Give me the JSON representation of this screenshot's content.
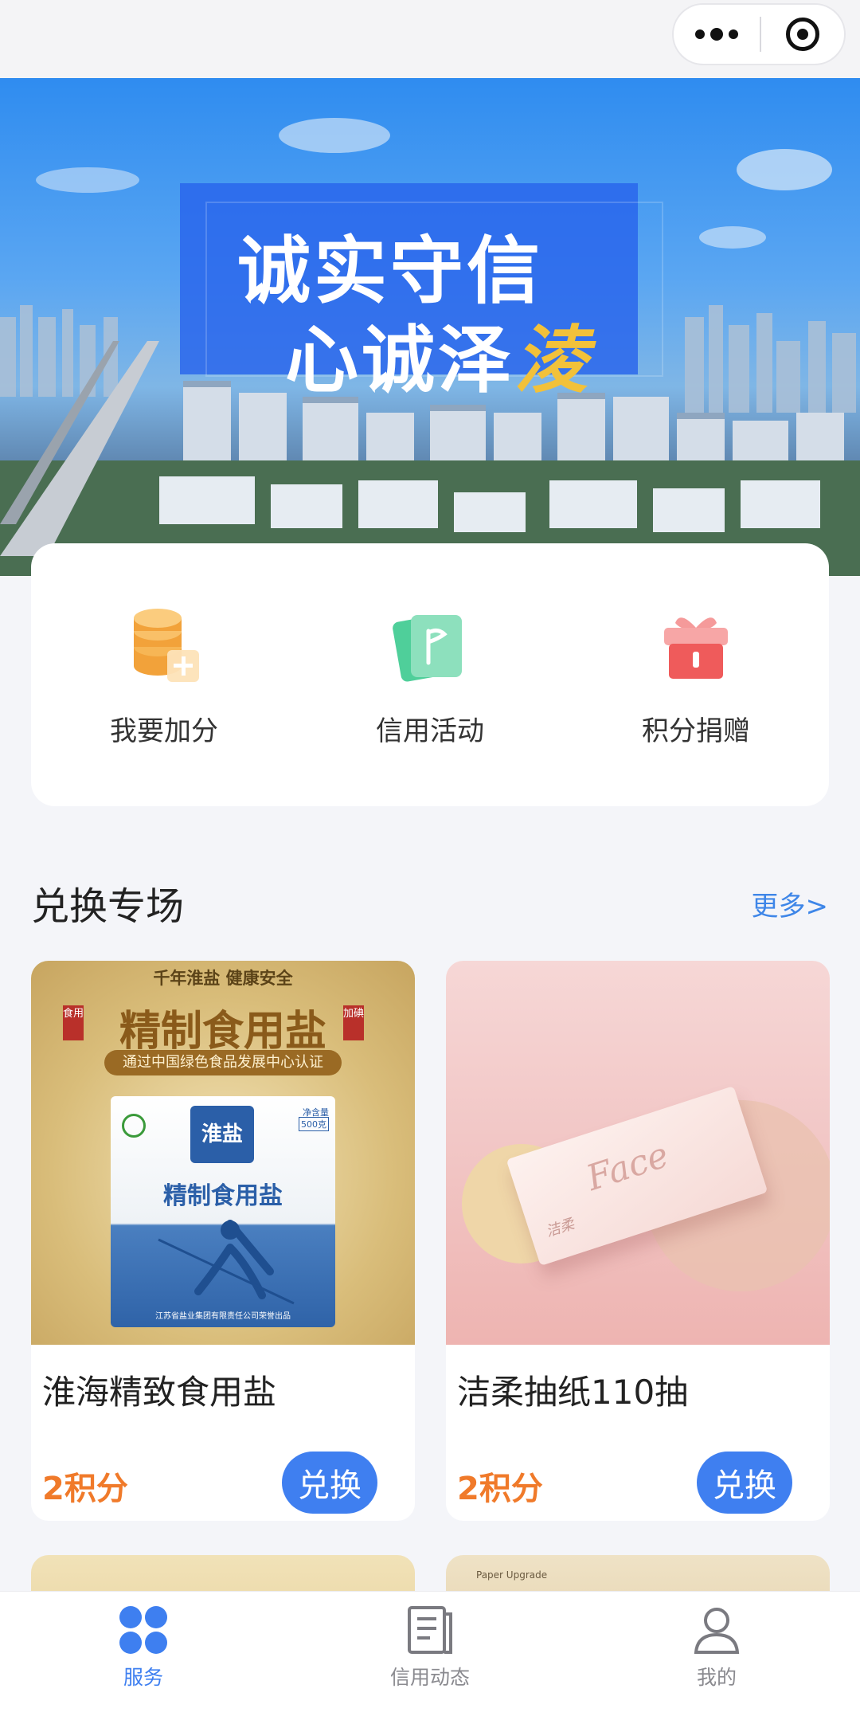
{
  "banner": {
    "line1": "诚实守信",
    "line2": "心诚泽",
    "line2_accent": "淩"
  },
  "quick_actions": [
    {
      "label": "我要加分",
      "icon": "coin-stack-plus-icon"
    },
    {
      "label": "信用活动",
      "icon": "flag-card-icon"
    },
    {
      "label": "积分捐赠",
      "icon": "gift-box-icon"
    }
  ],
  "section": {
    "title": "兑换专场",
    "more": "更多>"
  },
  "products": [
    {
      "name": "淮海精致食用盐",
      "points": "2积分",
      "button": "兑换",
      "image": {
        "top": "千年淮盐 健康安全",
        "tag_left": "食用",
        "headline": "精制食用盐",
        "tag_right": "加碘",
        "cert": "通过中国绿色食品发展中心认证",
        "bag_brand": "淮盐",
        "bag_title": "精制食用盐",
        "bag_net": "净含量",
        "bag_weight": "500克",
        "bag_footer": "江苏省盐业集团有限责任公司荣誉出品"
      }
    },
    {
      "name": "洁柔抽纸110抽",
      "points": "2积分",
      "button": "兑换",
      "image": {
        "brand": "Face",
        "sub": "洁柔"
      }
    }
  ],
  "peek": {
    "caption": "Paper Upgrade"
  },
  "tabbar": [
    {
      "label": "服务",
      "icon": "clover-icon",
      "active": true
    },
    {
      "label": "信用动态",
      "icon": "document-icon",
      "active": false
    },
    {
      "label": "我的",
      "icon": "user-icon",
      "active": false
    }
  ],
  "colors": {
    "accent": "#3f7ff0",
    "points": "#f07a2a",
    "background": "#f4f5f9"
  }
}
